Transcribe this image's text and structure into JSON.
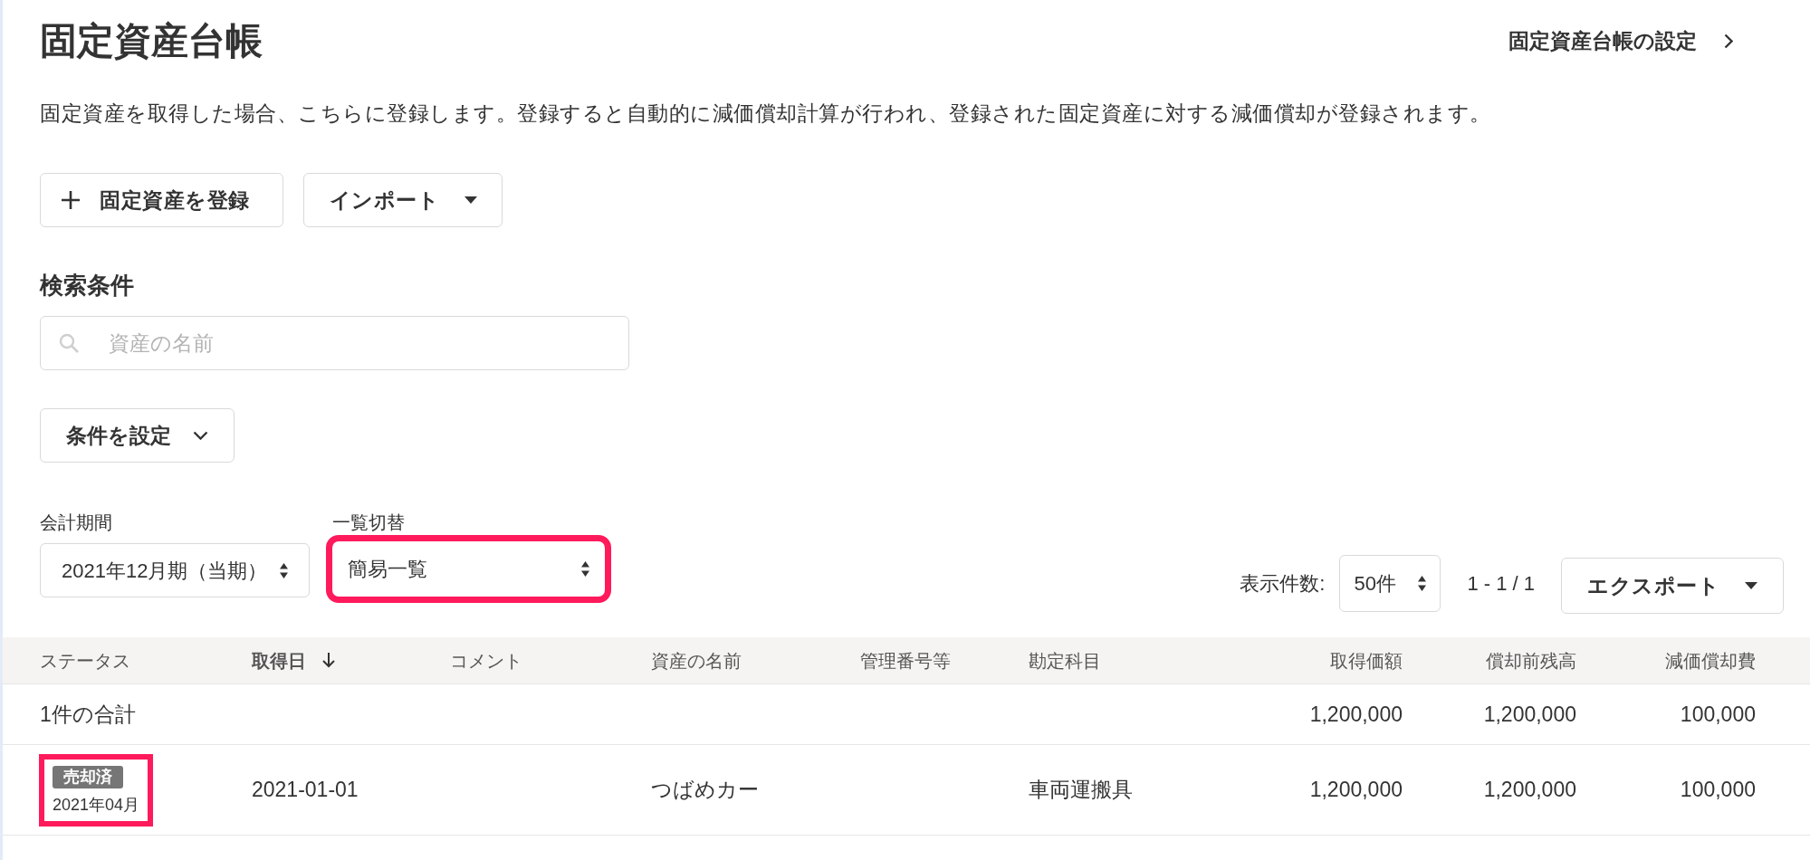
{
  "page": {
    "title": "固定資産台帳",
    "settings_link": "固定資産台帳の設定",
    "description": "固定資産を取得した場合、こちらに登録します。登録すると自動的に減価償却計算が行われ、登録された固定資産に対する減価償却が登録されます。"
  },
  "actions": [
    {
      "kind": "add",
      "label": "固定資産を登録"
    },
    {
      "kind": "menu",
      "label": "インポート"
    }
  ],
  "search": {
    "heading": "検索条件",
    "placeholder": "資産の名前",
    "filter_button": "条件を設定"
  },
  "filters": [
    {
      "label": "会計期間",
      "value": "2021年12月期（当期）",
      "highlighted": false
    },
    {
      "label": "一覧切替",
      "value": "簡易一覧",
      "highlighted": true
    }
  ],
  "list_controls": {
    "per_page_label": "表示件数:",
    "per_page": "50件",
    "range": "1 - 1 / 1",
    "export_button": "エクスポート"
  },
  "table": {
    "columns": [
      {
        "label": "ステータス",
        "kind": "text",
        "sorted": false
      },
      {
        "label": "取得日",
        "kind": "text",
        "sorted": true
      },
      {
        "label": "コメント",
        "kind": "text",
        "sorted": false
      },
      {
        "label": "資産の名前",
        "kind": "text",
        "sorted": false
      },
      {
        "label": "管理番号等",
        "kind": "text",
        "sorted": false
      },
      {
        "label": "勘定科目",
        "kind": "text",
        "sorted": false
      },
      {
        "label": "取得価額",
        "kind": "amount",
        "sorted": false
      },
      {
        "label": "償却前残高",
        "kind": "amount",
        "sorted": false
      },
      {
        "label": "減価償却費",
        "kind": "amount",
        "sorted": false
      }
    ],
    "summary": {
      "label": "1件の合計",
      "acquisition_cost": "1,200,000",
      "book_value": "1,200,000",
      "depreciation": "100,000"
    },
    "rows": [
      {
        "status": {
          "badge": "売却済",
          "date": "2021年04月",
          "highlighted": true
        },
        "acquired_on": "2021-01-01",
        "asset_name": "つばめカー",
        "account": "車両運搬具",
        "acquisition_cost": "1,200,000",
        "book_value": "1,200,000",
        "depreciation": "100,000"
      }
    ]
  }
}
